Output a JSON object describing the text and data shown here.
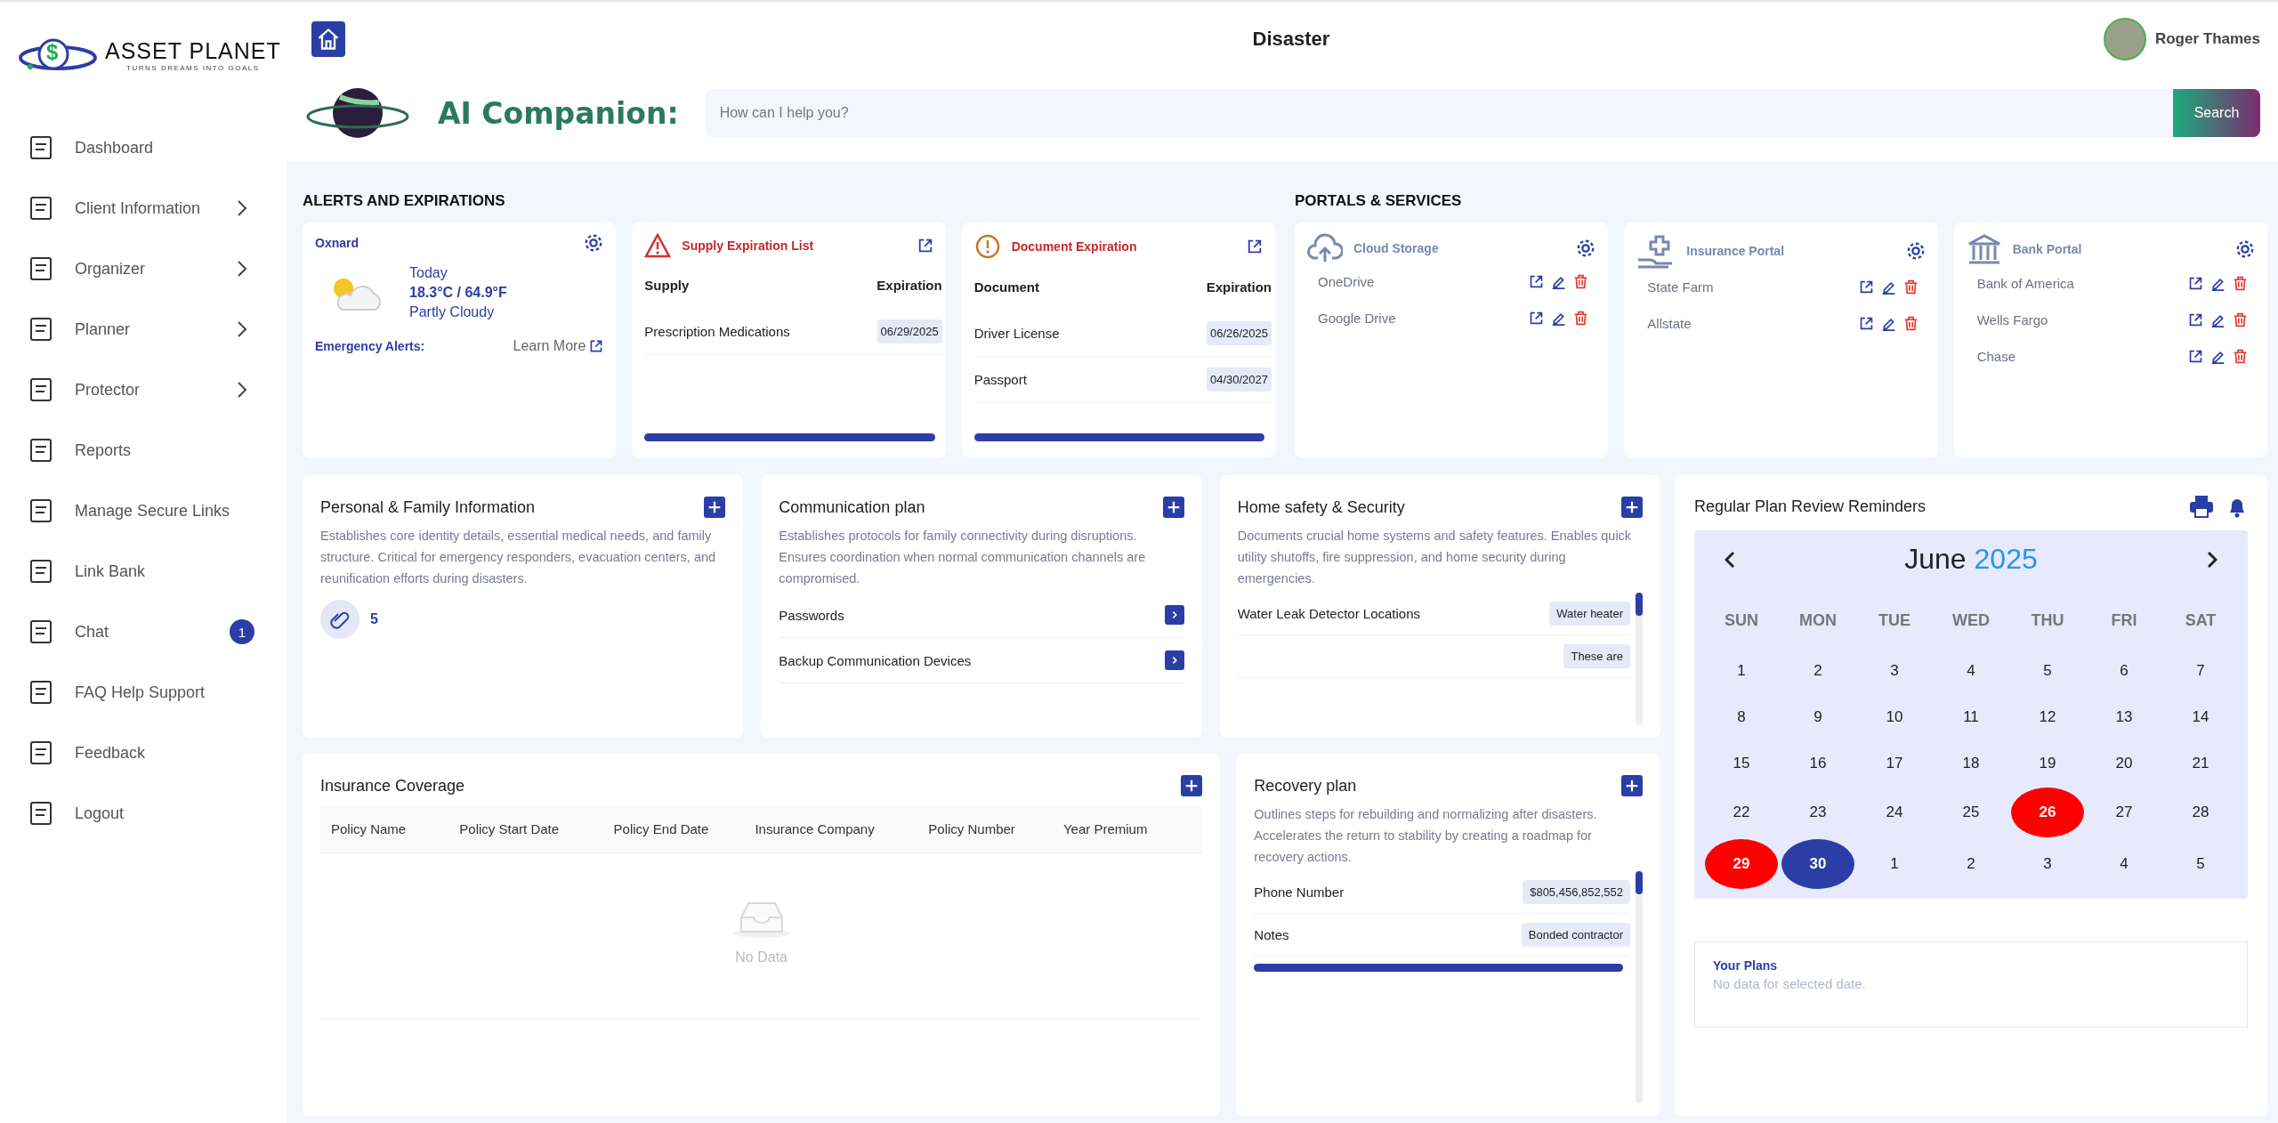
{
  "brand": {
    "symbol": "$",
    "name": "ASSET PLANET",
    "tagline": "TURNS DREAMS INTO GOALS"
  },
  "sidebar": {
    "items": [
      {
        "label": "Dashboard",
        "has_submenu": false
      },
      {
        "label": "Client Information",
        "has_submenu": true
      },
      {
        "label": "Organizer",
        "has_submenu": true
      },
      {
        "label": "Planner",
        "has_submenu": true
      },
      {
        "label": "Protector",
        "has_submenu": true
      },
      {
        "label": "Reports",
        "has_submenu": false
      },
      {
        "label": "Manage Secure Links",
        "has_submenu": false
      },
      {
        "label": "Link Bank",
        "has_submenu": false
      },
      {
        "label": "Chat",
        "has_submenu": false,
        "badge": "1"
      },
      {
        "label": "FAQ Help Support",
        "has_submenu": false
      },
      {
        "label": "Feedback",
        "has_submenu": false
      },
      {
        "label": "Logout",
        "has_submenu": false
      }
    ]
  },
  "header": {
    "title": "Disaster",
    "user": "Roger Thames"
  },
  "ai": {
    "title": "AI Companion:",
    "placeholder": "How can I help you?",
    "button": "Search"
  },
  "alerts": {
    "title": "ALERTS AND EXPIRATIONS",
    "weather": {
      "location": "Oxnard",
      "day": "Today",
      "temperature": "18.3°C / 64.9°F",
      "condition": "Partly Cloudy",
      "alerts_label": "Emergency Alerts:",
      "link": "Learn More"
    },
    "lists": [
      {
        "kind": "warning",
        "title": "Supply Expiration List",
        "columns": [
          "Supply",
          "Expiration"
        ],
        "rows": [
          {
            "name": "Prescription Medications",
            "date": "06/29/2025"
          }
        ]
      },
      {
        "kind": "notice",
        "title": "Document Expiration",
        "columns": [
          "Document",
          "Expiration"
        ],
        "rows": [
          {
            "name": "Driver License",
            "date": "06/26/2025"
          },
          {
            "name": "Passport",
            "date": "04/30/2027"
          }
        ]
      }
    ]
  },
  "portals": {
    "title": "PORTALS & SERVICES",
    "cards": [
      {
        "kind": "cloud",
        "title": "Cloud Storage",
        "items": [
          "OneDrive",
          "Google Drive"
        ]
      },
      {
        "kind": "insurance",
        "title": "Insurance Portal",
        "items": [
          "State Farm",
          "Allstate"
        ]
      },
      {
        "kind": "bank",
        "title": "Bank Portal",
        "items": [
          "Bank of America",
          "Wells Fargo",
          "Chase"
        ]
      }
    ]
  },
  "plans": [
    {
      "kind": "attachments",
      "title": "Personal & Family Information",
      "description": "Establishes core identity details, essential medical needs, and family structure. Critical for emergency responders, evacuation centers, and reunification efforts during disasters.",
      "count": "5"
    },
    {
      "kind": "links",
      "title": "Communication plan",
      "description": "Establishes protocols for family connectivity during disruptions. Ensures coordination when normal communication channels are compromised.",
      "links": [
        "Passwords",
        "Backup Communication Devices"
      ]
    },
    {
      "kind": "entries",
      "title": "Home safety & Security",
      "description": "Documents crucial home systems and safety features. Enables quick utility shutoffs, fire suppression, and home security during emergencies.",
      "entries": [
        {
          "label": "Water Leak Detector Locations",
          "value": "Water heater"
        },
        {
          "value": "These are"
        }
      ]
    }
  ],
  "insurance": {
    "title": "Insurance Coverage",
    "columns": [
      "Policy Name",
      "Policy Start Date",
      "Policy End Date",
      "Insurance Company",
      "Policy Number",
      "Year Premium"
    ],
    "empty": "No Data"
  },
  "recovery": {
    "title": "Recovery plan",
    "description": "Outlines steps for rebuilding and normalizing after disasters. Accelerates the return to stability by creating a roadmap for recovery actions.",
    "entries": [
      {
        "label": "Phone Number",
        "value": "$805,456,852,552"
      },
      {
        "label": "Notes",
        "value": "Bonded contractor"
      }
    ]
  },
  "calendar": {
    "title": "Regular Plan Review Reminders",
    "month": "June",
    "year": "2025",
    "weekdays": [
      "SUN",
      "MON",
      "TUE",
      "WED",
      "THU",
      "FRI",
      "SAT"
    ],
    "days": [
      {
        "label": "1"
      },
      {
        "label": "2"
      },
      {
        "label": "3"
      },
      {
        "label": "4"
      },
      {
        "label": "5"
      },
      {
        "label": "6"
      },
      {
        "label": "7"
      },
      {
        "label": "8"
      },
      {
        "label": "9"
      },
      {
        "label": "10"
      },
      {
        "label": "11"
      },
      {
        "label": "12"
      },
      {
        "label": "13"
      },
      {
        "label": "14"
      },
      {
        "label": "15"
      },
      {
        "label": "16"
      },
      {
        "label": "17"
      },
      {
        "label": "18"
      },
      {
        "label": "19"
      },
      {
        "label": "20"
      },
      {
        "label": "21"
      },
      {
        "label": "22"
      },
      {
        "label": "23"
      },
      {
        "label": "24"
      },
      {
        "label": "25"
      },
      {
        "label": "26",
        "color": "#ff0000"
      },
      {
        "label": "27"
      },
      {
        "label": "28"
      },
      {
        "label": "29",
        "color": "#ff0000"
      },
      {
        "label": "30",
        "color": "#2b3ea6"
      },
      {
        "label": "1"
      },
      {
        "label": "2"
      },
      {
        "label": "3"
      },
      {
        "label": "4"
      },
      {
        "label": "5"
      }
    ],
    "plans_title": "Your Plans",
    "plans_empty": "No data for selected date."
  }
}
